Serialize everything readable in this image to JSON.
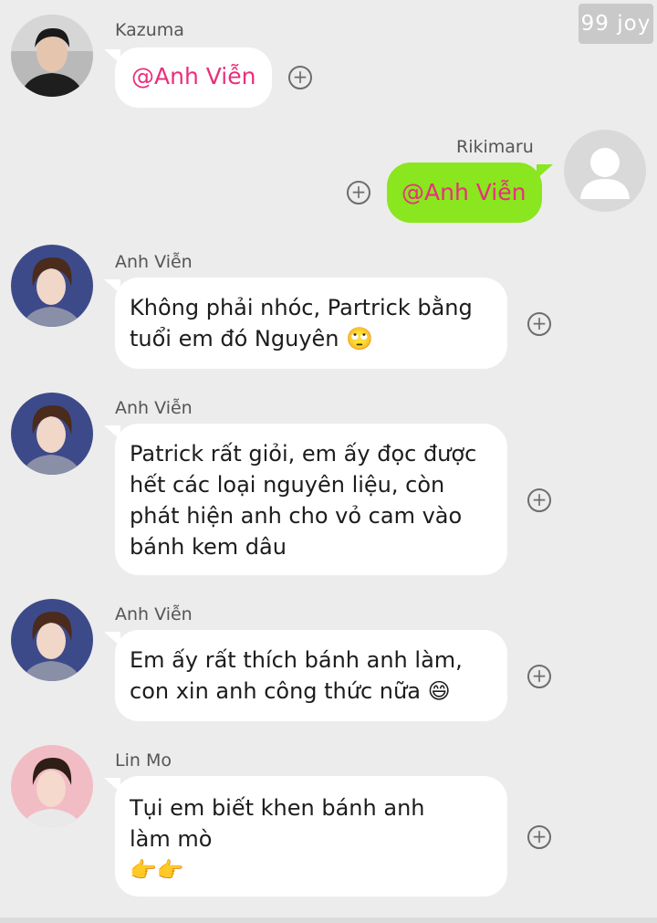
{
  "watermark": "99 joy",
  "messages": [
    {
      "sender": "Kazuma",
      "text": "@Anh Viễn"
    },
    {
      "sender": "Rikimaru",
      "text": "@Anh Viễn"
    },
    {
      "sender": "Anh Viễn",
      "lines": [
        "Không phải nhóc, Partrick bằng",
        "tuổi em đó Nguyên"
      ],
      "emoji": "🙄"
    },
    {
      "sender": "Anh Viễn",
      "lines": [
        "Patrick rất giỏi, em ấy đọc được",
        "hết các loại nguyên liệu, còn",
        "phát hiện anh cho vỏ cam vào",
        "bánh kem dâu"
      ]
    },
    {
      "sender": "Anh Viễn",
      "lines": [
        "Em ấy rất thích bánh anh làm,",
        "con xin anh công thức nữa"
      ],
      "emoji": "😄"
    },
    {
      "sender": "Lin Mo",
      "lines": [
        "Tụi em biết khen bánh anh",
        "làm mò"
      ],
      "emoji": "👉👉"
    }
  ],
  "colors": {
    "background": "#ececec",
    "bubble": "#ffffff",
    "own_bubble": "#8ae61e",
    "mention": "#ea2e7d"
  },
  "icons": {
    "add_reaction": "plus-circle-icon",
    "default_avatar": "person-icon"
  }
}
